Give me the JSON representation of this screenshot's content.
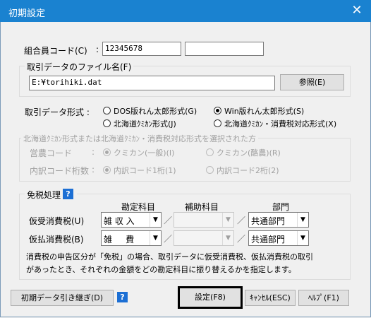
{
  "window": {
    "title": "初期設定",
    "close_glyph": "✕"
  },
  "member_code": {
    "label": "組合員コード(C)",
    "colon": ":",
    "value": "12345678",
    "value2": ""
  },
  "file_group": {
    "legend": "取引データのファイル名(F)",
    "path": "E:¥torihiki.dat",
    "browse_label": "参照(E)"
  },
  "format": {
    "label": "取引データ形式 :",
    "options": [
      {
        "label": "DOS版れん太郎形式(G)",
        "checked": false
      },
      {
        "label": "Win版れん太郎形式(S)",
        "checked": true
      },
      {
        "label": "北海道ｸﾐｶﾝ形式(J)",
        "checked": false
      },
      {
        "label": "北海道ｸﾐｶﾝ・消費税対応形式(X)",
        "checked": false
      }
    ]
  },
  "hokkaido_group": {
    "legend": "北海道ｸﾐｶﾝ形式または北海道ｸﾐｶﾝ・消費税対応形式を選択された方",
    "eino_label": "営農コード",
    "eino_colon": ":",
    "eino_options": [
      {
        "label": "クミカン(一般)(I)",
        "checked": true
      },
      {
        "label": "クミカン(酪農)(R)",
        "checked": false
      }
    ],
    "detail_label": "内訳コード桁数",
    "detail_colon": ":",
    "detail_options": [
      {
        "label": "内訳コード1桁(1)",
        "checked": true
      },
      {
        "label": "内訳コード2桁(2)",
        "checked": false
      }
    ]
  },
  "tax_group": {
    "legend": "免税処理",
    "help_glyph": "?",
    "col_account": "勘定科目",
    "col_sub": "補助科目",
    "col_dept": "部門",
    "slash": "／",
    "rows": [
      {
        "label": "仮受消費税(U)",
        "account": "雑 収 入",
        "sub": "",
        "dept": "共通部門"
      },
      {
        "label": "仮払消費税(B)",
        "account": "雑     費",
        "sub": "",
        "dept": "共通部門"
      }
    ],
    "description_line1": "消費税の申告区分が「免税」の場合、取引データに仮受消費税、仮払消費税の取引",
    "description_line2": "があったとき、それぞれの金額をどの勘定科目に振り替えるかを指定します。"
  },
  "footer": {
    "inherit_label": "初期データ引き継ぎ(D)",
    "help_glyph": "?",
    "ok_label": "設定(F8)",
    "cancel_label": "ｷｬﾝｾﾙ(ESC)",
    "help_label": "ﾍﾙﾌﾟ(F1)",
    "arrow_glyph": "▼"
  }
}
